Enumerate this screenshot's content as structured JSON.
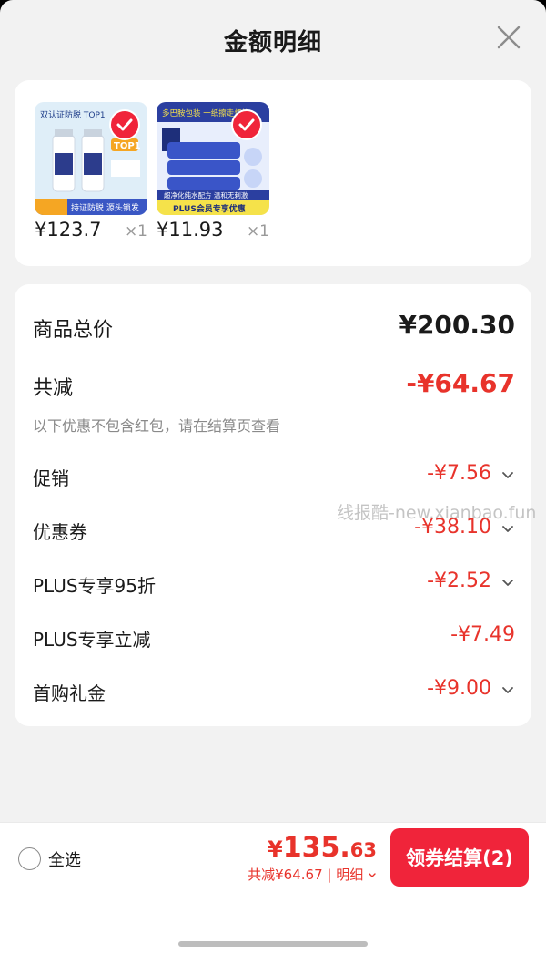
{
  "header": {
    "title": "金额明细",
    "close_icon": "close-icon"
  },
  "products": [
    {
      "price": "¥123.7",
      "qty": "×1",
      "thumb_texts": {
        "top": "双认证防脱 TOP1",
        "badge": "TOP1",
        "bottom": "持证防脱 源头锁发"
      },
      "colors": {
        "bg": "#dfeef8",
        "accent": "#f5a623",
        "bottle": "#ffffff",
        "label": "#2c3c8c"
      }
    },
    {
      "price": "¥11.93",
      "qty": "×1",
      "thumb_texts": {
        "top": "多巴胺包装 一纸擦走烦恼",
        "mid": "超净化纯水配方 温和无刺激",
        "bottom": "PLUS会员专享优惠"
      },
      "colors": {
        "bg": "#2b3fa0",
        "accent": "#f5e24a",
        "pack": "#3a55c8"
      }
    }
  ],
  "details": {
    "total_label": "商品总价",
    "total_value": "¥200.30",
    "reduce_label": "共减",
    "reduce_value": "-¥64.67",
    "note": "以下优惠不包含红包，请在结算页查看",
    "items": [
      {
        "label": "促销",
        "value": "-¥7.56",
        "expandable": true
      },
      {
        "label": "优惠券",
        "value": "-¥38.10",
        "expandable": true
      },
      {
        "label": "PLUS专享95折",
        "value": "-¥2.52",
        "expandable": true
      },
      {
        "label": "PLUS专享立减",
        "value": "-¥7.49",
        "expandable": false
      },
      {
        "label": "首购礼金",
        "value": "-¥9.00",
        "expandable": true
      }
    ]
  },
  "watermark": "线报酷-new.xianbao.fun",
  "footer": {
    "select_all": "全选",
    "price_symbol": "¥",
    "price_int": "135.",
    "price_dec": "63",
    "summary": "共减¥64.67 | 明细",
    "checkout": "领券结算(2)"
  },
  "colors": {
    "accent_red": "#e8332b",
    "button_red": "#f0243a",
    "background": "#f2f2f2"
  }
}
